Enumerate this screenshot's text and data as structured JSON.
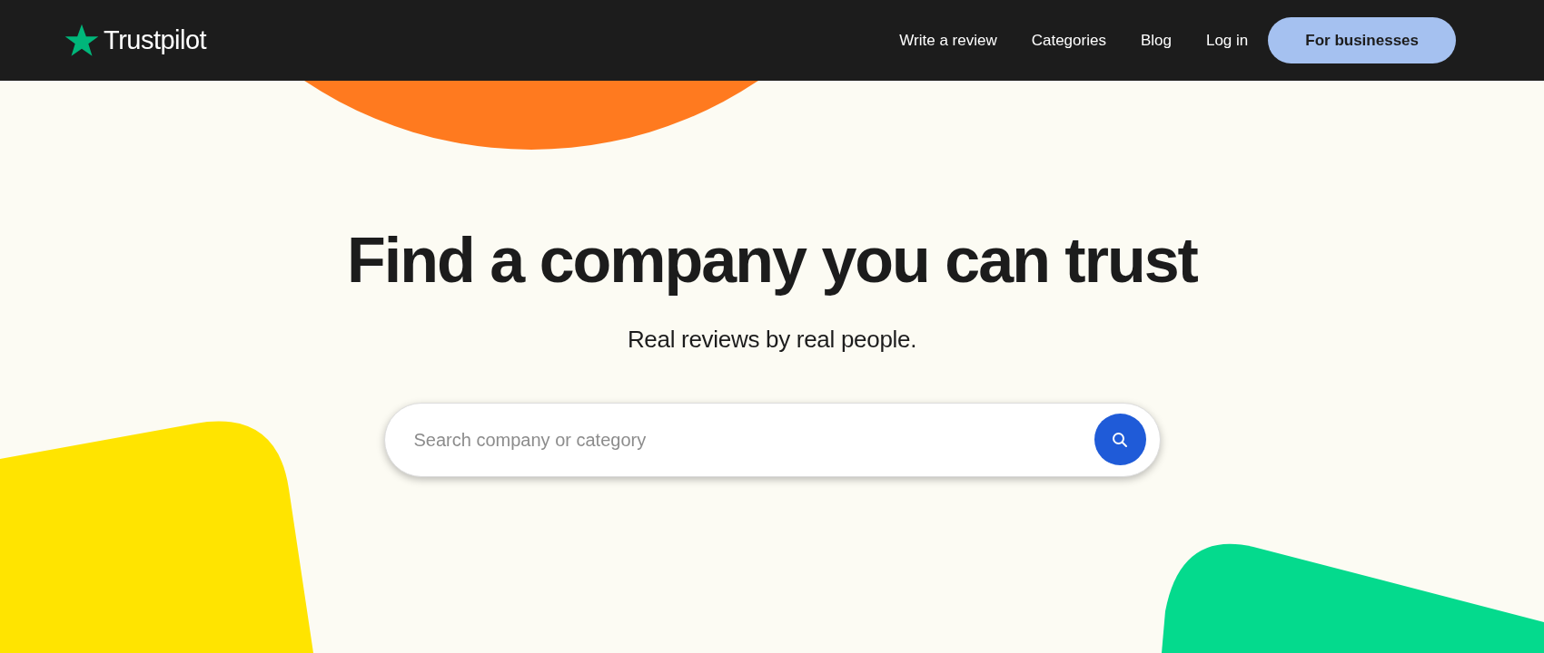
{
  "header": {
    "logo": "Trustpilot",
    "nav": [
      {
        "label": "Write a review"
      },
      {
        "label": "Categories"
      },
      {
        "label": "Blog"
      },
      {
        "label": "Log in"
      }
    ],
    "cta": "For businesses"
  },
  "hero": {
    "title": "Find a company you can trust",
    "subtitle": "Real reviews by real people.",
    "search": {
      "placeholder": "Search company or category"
    }
  }
}
